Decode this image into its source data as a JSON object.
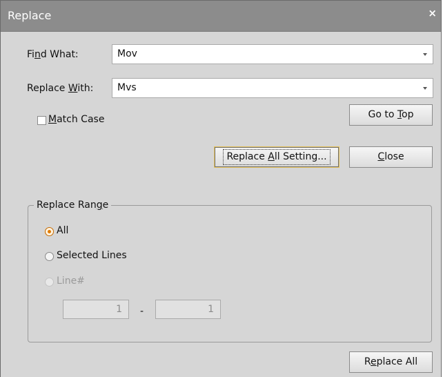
{
  "dialog": {
    "title": "Replace",
    "close_glyph": "×"
  },
  "find": {
    "label_pre": "Fi",
    "label_key": "n",
    "label_post": "d What:",
    "value": "Mov"
  },
  "replace": {
    "label_pre": "Replace ",
    "label_key": "W",
    "label_post": "ith:",
    "value": "Mvs"
  },
  "match_case": {
    "label_key": "M",
    "label_post": "atch Case",
    "checked": false
  },
  "buttons": {
    "go_to_top_pre": "Go to ",
    "go_to_top_key": "T",
    "go_to_top_post": "op",
    "replace_all_setting_pre": "Replace ",
    "replace_all_setting_key": "A",
    "replace_all_setting_post": "ll Setting...",
    "close_key": "C",
    "close_post": "lose",
    "replace_all_pre": "R",
    "replace_all_key": "e",
    "replace_all_post": "place All"
  },
  "replace_range": {
    "legend_pre": "Replace Ran",
    "legend_key": "g",
    "legend_post": "e",
    "options": {
      "all": "All",
      "selected_lines": "Selected Lines",
      "line_number": "Line#"
    },
    "selected": "all",
    "line_from": "1",
    "separator": "-",
    "line_to": "1"
  },
  "colors": {
    "titlebar": "#8c8c8c",
    "dialog_bg": "#d6d6d6",
    "focus_border": "#e7c35a",
    "radio_accent": "#e07a00"
  },
  "icons": [
    "close-icon",
    "dropdown-arrow-icon",
    "checkbox",
    "radio"
  ]
}
